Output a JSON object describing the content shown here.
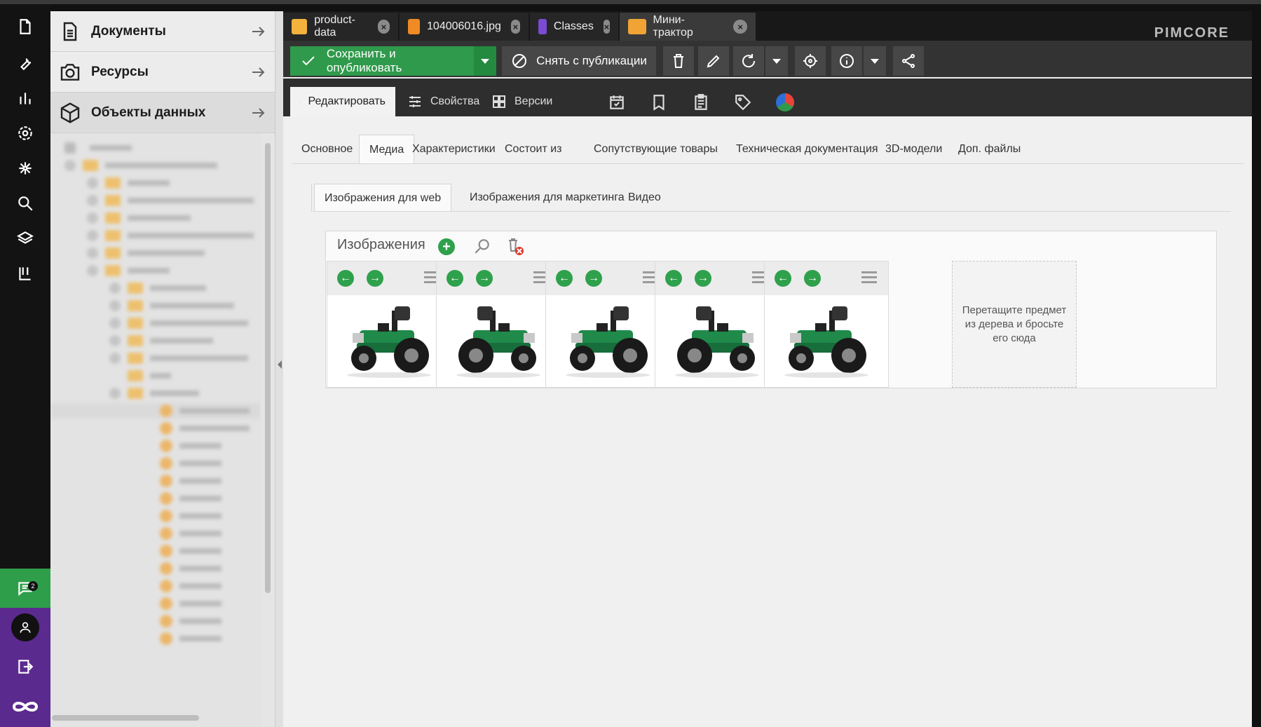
{
  "app": {
    "logo": "PIMCORE"
  },
  "rail": {
    "chat_badge": "2"
  },
  "tree": {
    "accordions": [
      {
        "label": "Документы"
      },
      {
        "label": "Ресурсы"
      },
      {
        "label": "Объекты данных"
      }
    ]
  },
  "doc_tabs": [
    {
      "label": "product-data",
      "icon": "folder-icon",
      "color": "#f2b23c"
    },
    {
      "label": "104006016.jpg",
      "icon": "image-icon",
      "color": "#f08a24"
    },
    {
      "label": "Classes",
      "icon": "classes-icon",
      "color": "#7b4bd3"
    },
    {
      "label": "Мини-трактор",
      "icon": "object-icon",
      "color": "#f0a436"
    }
  ],
  "toolbar": {
    "save_label": "Сохранить и опубликовать",
    "unpublish_label": "Снять с публикации"
  },
  "subtabs": {
    "edit": "Редактировать",
    "properties": "Свойства",
    "versions": "Версии"
  },
  "panel_tabs": [
    "Основное",
    "Медиа",
    "Характеристики",
    "Состоит из",
    "Сопутствующие товары",
    "Техническая документация",
    "3D-модели",
    "Доп. файлы"
  ],
  "media_tabs": [
    "Изображения для web",
    "Изображения для маркетинга",
    "Видео"
  ],
  "gallery": {
    "title": "Изображения",
    "drop_hint": "Перетащите предмет из дерева и бросьте его сюда",
    "image_count": 5
  },
  "colors": {
    "accent_green": "#2f9a4b",
    "tractor_green": "#1f8a4a"
  }
}
